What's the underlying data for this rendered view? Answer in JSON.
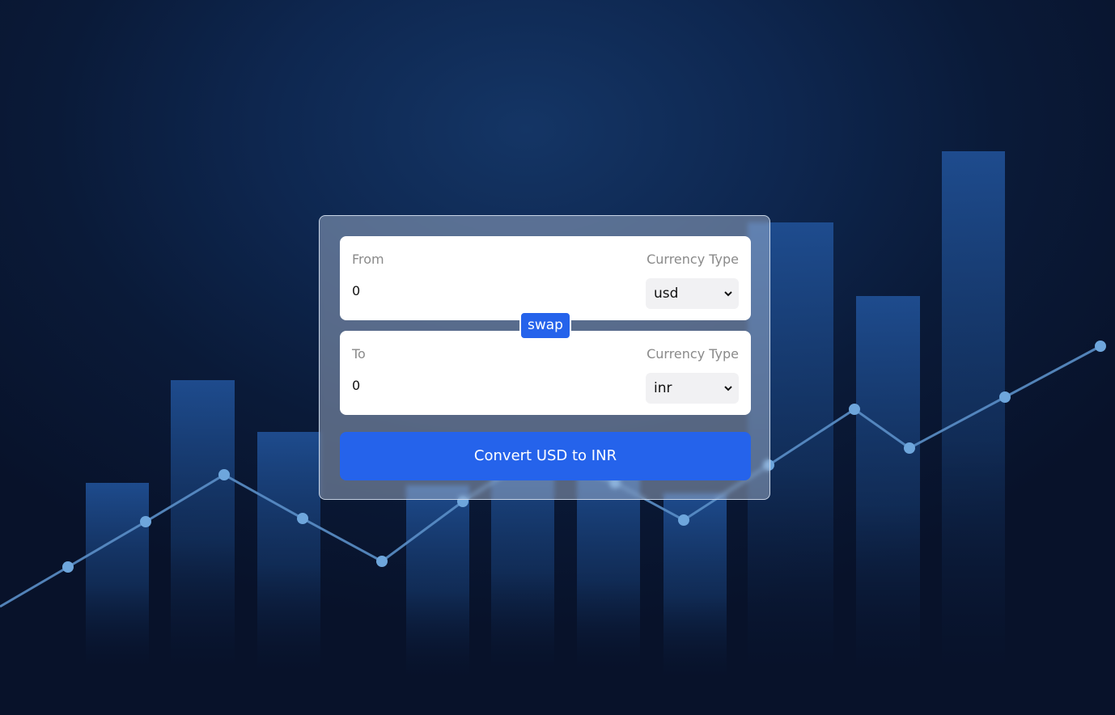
{
  "converter": {
    "from": {
      "label": "From",
      "currency_label": "Currency Type",
      "amount": "0",
      "currency": "usd"
    },
    "to": {
      "label": "To",
      "currency_label": "Currency Type",
      "amount": "0",
      "currency": "inr"
    },
    "swap_label": "swap",
    "convert_label": "Convert USD to INR"
  },
  "colors": {
    "accent": "#2563eb",
    "background": "#0a1a38",
    "card_text_muted": "#8a8a8a"
  },
  "icons": {
    "dropdown": "chevron-down-icon"
  }
}
